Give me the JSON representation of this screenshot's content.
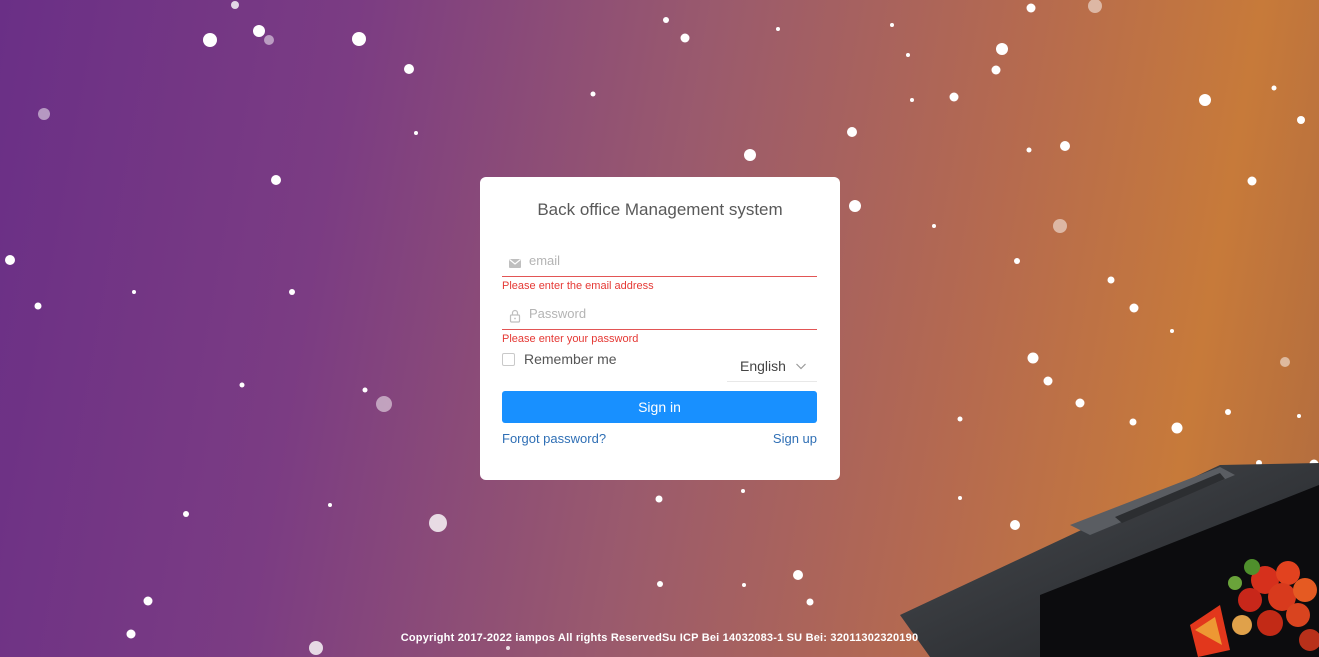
{
  "login": {
    "title": "Back office Management system",
    "email_placeholder": "email",
    "email_error": "Please enter the email address",
    "password_placeholder": "Password",
    "password_error": "Please enter your password",
    "remember_label": "Remember me",
    "remember_checked": false,
    "language": "English",
    "signin_label": "Sign in",
    "forgot_label": "Forgot password?",
    "signup_label": "Sign up"
  },
  "footer": {
    "copyright": "Copyright 2017-2022 iampos All rights ReservedSu ICP Bei 14032083-1 SU Bei: 32011302320190"
  },
  "icons": {
    "email": "mail-icon",
    "password": "lock-icon",
    "language": "chevron-down-icon"
  },
  "colors": {
    "primary": "#1890ff",
    "error": "#e53935",
    "link": "#2f6fb5"
  }
}
